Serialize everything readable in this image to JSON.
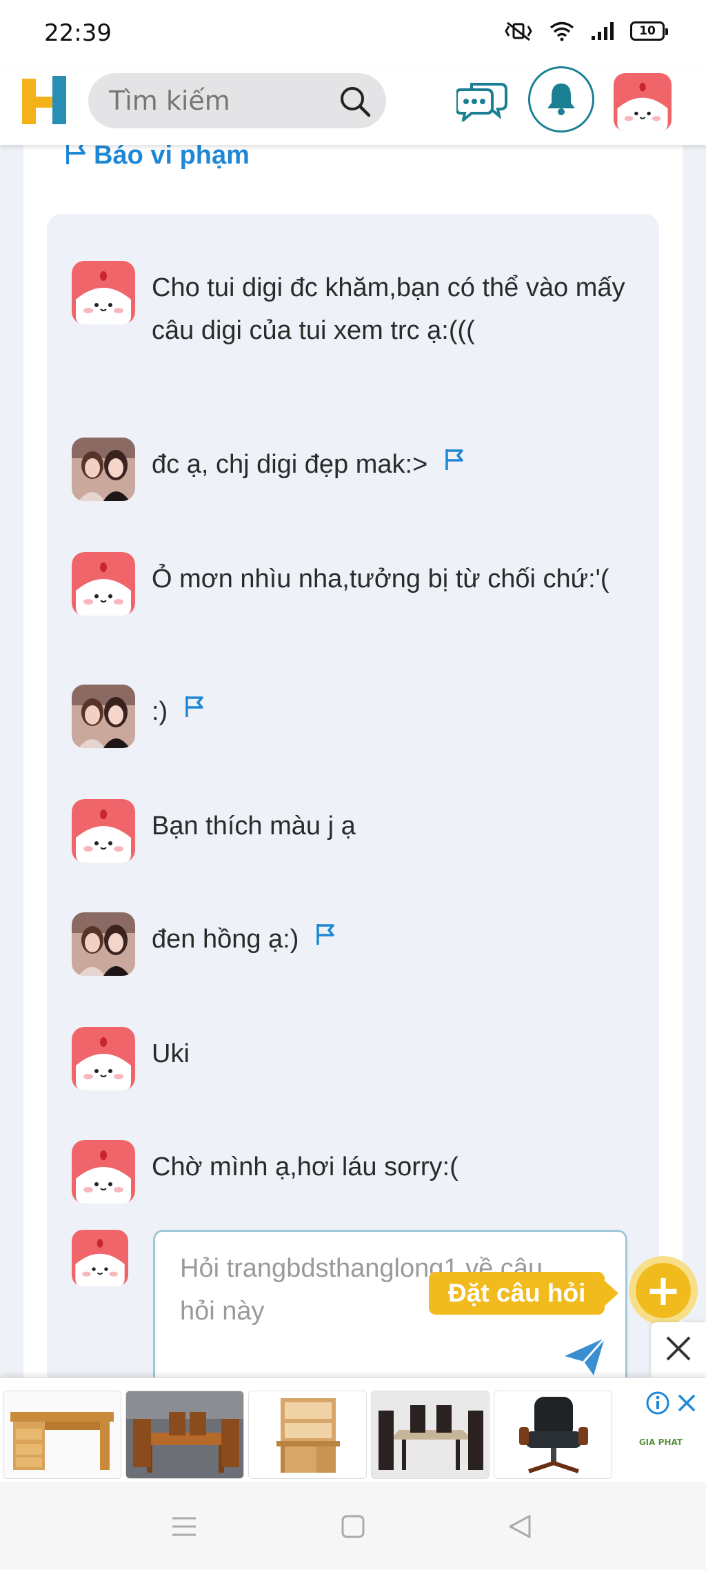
{
  "status_bar": {
    "time": "22:39",
    "battery": "10",
    "icons": [
      "vibrate-mute-icon",
      "wifi-icon",
      "signal-icon",
      "battery-icon"
    ]
  },
  "header": {
    "logo": "H",
    "search_placeholder": "Tìm kiếm",
    "icons": [
      "search-icon",
      "chat-icon",
      "bell-icon",
      "avatar"
    ]
  },
  "report_link": "Báo vi phạm",
  "messages": [
    {
      "user": "asker",
      "text": "Cho tui digi đc khăm,bạn có thể vào mấy câu digi của tui xem trc ạ:(((",
      "flag": false
    },
    {
      "user": "answerer",
      "text": "đc ạ, chj digi đẹp mak:>",
      "flag": true
    },
    {
      "user": "asker",
      "text": "Ỏ mơn nhìu nha,tưởng bị từ chối chứ:'(",
      "flag": false
    },
    {
      "user": "answerer",
      "text": ":)",
      "flag": true
    },
    {
      "user": "asker",
      "text": "Bạn thích màu j ạ",
      "flag": false
    },
    {
      "user": "answerer",
      "text": "đen hồng ạ:)",
      "flag": true
    },
    {
      "user": "asker",
      "text": "Uki",
      "flag": false
    },
    {
      "user": "asker",
      "text": "Chờ mình ạ,hơi láu sorry:(",
      "flag": false
    }
  ],
  "reply": {
    "placeholder": "Hỏi trangbdsthanglong1 về câu hỏi này"
  },
  "ask_button": "Đặt câu hỏi",
  "ad": {
    "items": [
      "office-desk",
      "dining-table",
      "study-desk-shelf",
      "marble-dining-set",
      "leather-office-chair"
    ],
    "brand": "GIA PHAT"
  },
  "colors": {
    "brand_blue": "#1e88d6",
    "teal": "#1b7f94",
    "accent_yellow": "#f1bb1d",
    "chat_bg": "#eef2f8"
  }
}
